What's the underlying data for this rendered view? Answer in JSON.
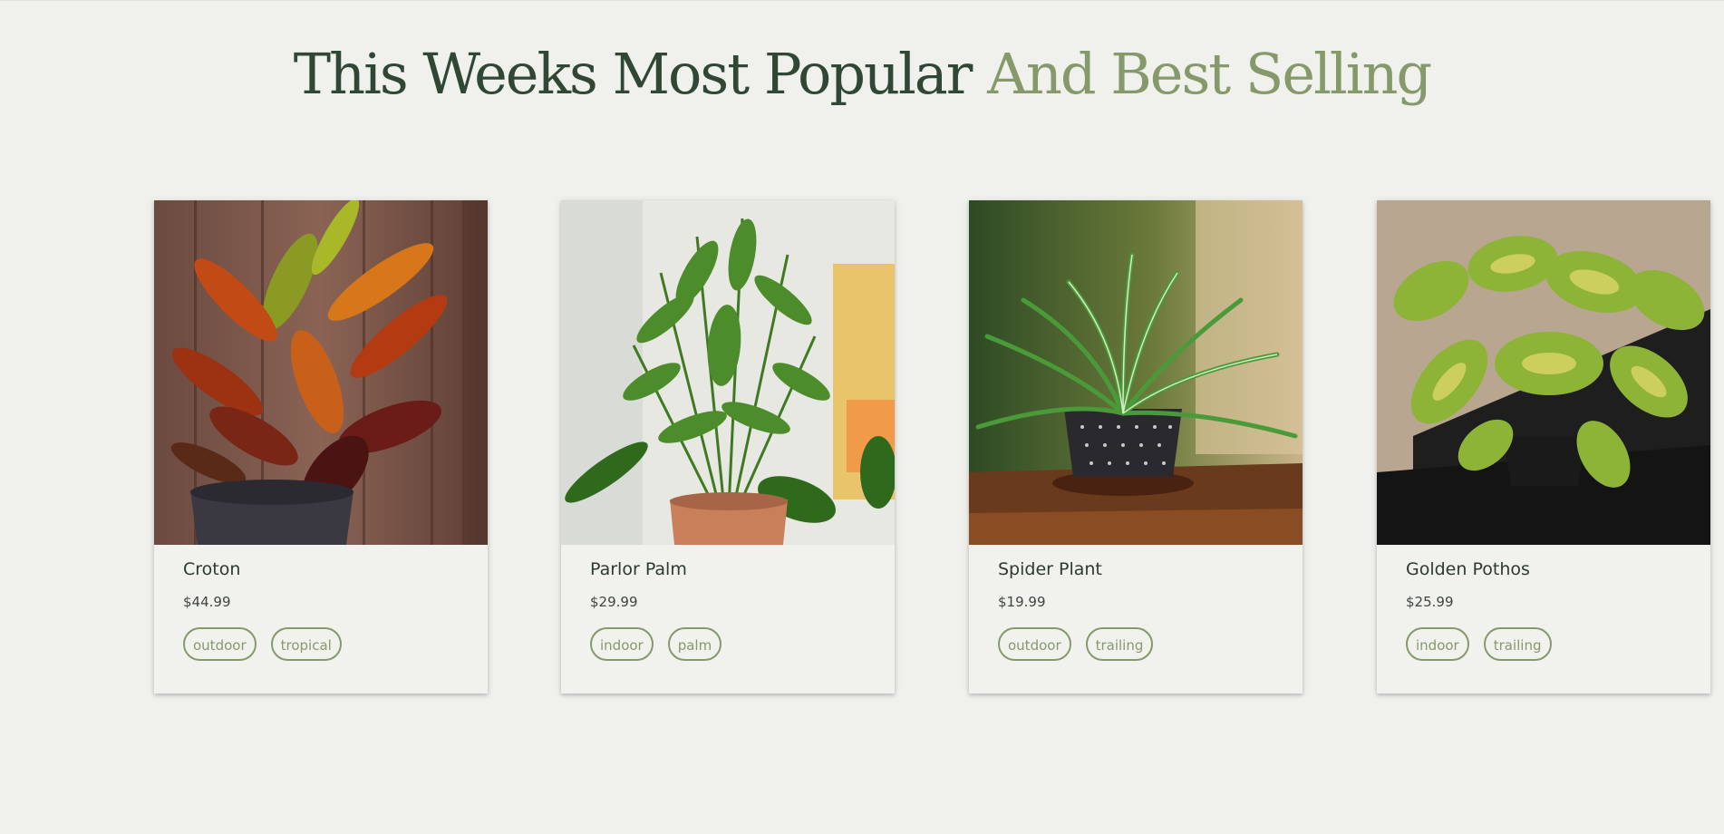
{
  "heading": {
    "dark": "This Weeks Most Popular",
    "light": "And Best Selling"
  },
  "colors": {
    "dark_green": "#2f4734",
    "sage_green": "#86996a",
    "background": "#f0f0ed"
  },
  "products": [
    {
      "name": "Croton",
      "price": "$44.99",
      "tags": [
        "outdoor",
        "tropical"
      ],
      "image": "croton-plant-photo"
    },
    {
      "name": "Parlor Palm",
      "price": "$29.99",
      "tags": [
        "indoor",
        "palm"
      ],
      "image": "parlor-palm-photo"
    },
    {
      "name": "Spider Plant",
      "price": "$19.99",
      "tags": [
        "outdoor",
        "trailing"
      ],
      "image": "spider-plant-photo"
    },
    {
      "name": "Golden Pothos",
      "price": "$25.99",
      "tags": [
        "indoor",
        "trailing"
      ],
      "image": "golden-pothos-photo"
    }
  ]
}
